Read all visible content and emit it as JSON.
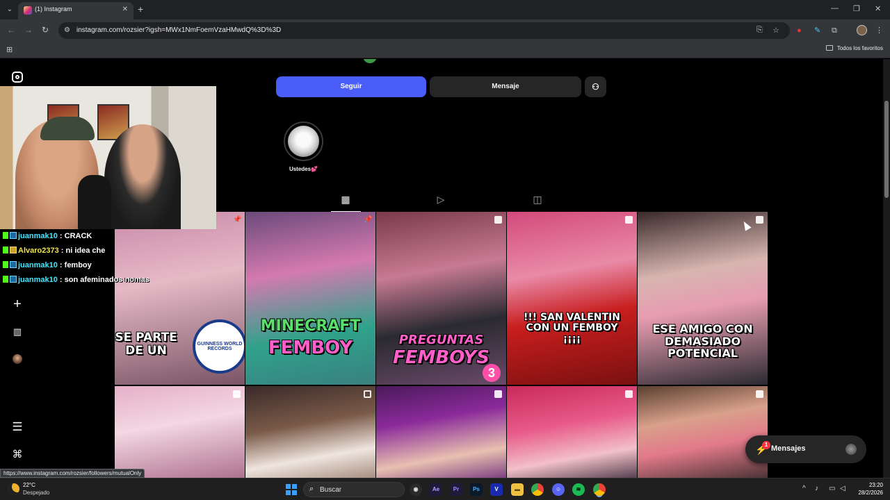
{
  "browser": {
    "tab_title": "(1) Instagram",
    "tab_close": "✕",
    "new_tab": "+",
    "window_minimize": "—",
    "window_restore": "❐",
    "window_close": "✕",
    "url": "instagram.com/rozsier?igsh=MWx1NmFoemVzaHMwdQ%3D%3D",
    "bookmarks_all": "Todos los favoritos",
    "status_url": "https://www.instagram.com/rozsier/followers/mutualOnly"
  },
  "profile": {
    "follow_label": "Seguir",
    "message_label": "Mensaje",
    "add_user_icon": "person-add-icon",
    "highlight_label": "Ustedes💕"
  },
  "tabs": [
    "grid-icon",
    "reels-icon",
    "tagged-icon"
  ],
  "posts": [
    {
      "caption": "SE PARTE DE UN",
      "extra": "GUINNESS WORLD RECORDS",
      "type": "pinned"
    },
    {
      "caption": "MINECRAFT",
      "caption2": "FEMBOY",
      "type": "pinned"
    },
    {
      "caption": "PREGUNTAS",
      "caption2": "FEMBOYS",
      "badge": "3",
      "type": "reel"
    },
    {
      "caption": "!!! SAN VALENTIN CON UN FEMBOY ¡¡¡¡",
      "type": "reel"
    },
    {
      "caption": "ESE AMIGO CON DEMASIADO POTENCIAL",
      "type": "reel"
    },
    {
      "caption": "",
      "type": "reel"
    },
    {
      "caption": "",
      "type": "carousel"
    },
    {
      "caption": "",
      "type": "reel"
    },
    {
      "caption": "",
      "type": "reel"
    },
    {
      "caption": "",
      "type": "reel"
    }
  ],
  "chat": [
    {
      "user": "juanmak10",
      "sep": " : ",
      "msg": "CRACK"
    },
    {
      "user": "Alvaro2373",
      "sep": " : ",
      "msg": "ni idea che"
    },
    {
      "user": "juanmak10",
      "sep": " : ",
      "msg": "femboy"
    },
    {
      "user": "juanmak10",
      "sep": " : ",
      "msg": "son afeminados nomas"
    }
  ],
  "messages": {
    "label": "Mensajes",
    "badge": "1"
  },
  "taskbar": {
    "temp": "22°C",
    "weather": "Despejado",
    "search_label": "Buscar",
    "time": "23:20",
    "date": "28/2/2026"
  },
  "colors": {
    "follow_button": "#4a5df9",
    "secondary_button": "#262626",
    "chat_user": "#3fe8ff"
  }
}
